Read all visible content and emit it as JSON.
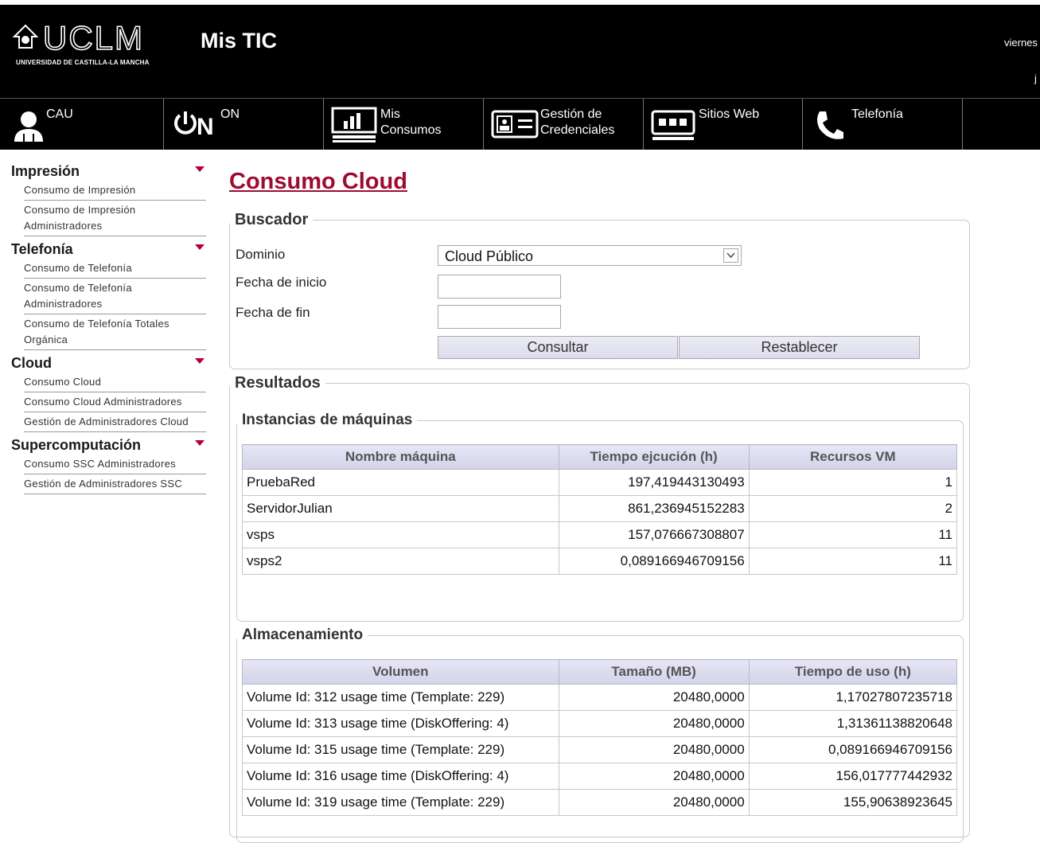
{
  "header": {
    "logo_text": "UCLM",
    "logo_subtitle": "UNIVERSIDAD DE CASTILLA-LA MANCHA",
    "app_title": "Mis TIC",
    "date_partial": "viernes",
    "user_partial": "j"
  },
  "nav": {
    "items": [
      {
        "label": "CAU",
        "icon": "person-icon"
      },
      {
        "label": "ON",
        "icon": "power-on-icon"
      },
      {
        "label": "Mis\nConsumos",
        "icon": "bar-chart-icon"
      },
      {
        "label": "Gestión de\nCredenciales",
        "icon": "id-card-icon"
      },
      {
        "label": "Sitios Web",
        "icon": "web-grid-icon"
      },
      {
        "label": "Telefonía",
        "icon": "phone-icon"
      }
    ]
  },
  "sidebar": {
    "sections": [
      {
        "title": "Impresión",
        "items": [
          "Consumo de Impresión",
          "Consumo de Impresión Administradores"
        ]
      },
      {
        "title": "Telefonía",
        "items": [
          "Consumo de Telefonía",
          "Consumo de Telefonía Administradores",
          "Consumo de Telefonía Totales Orgánica"
        ]
      },
      {
        "title": "Cloud",
        "items": [
          "Consumo Cloud",
          "Consumo Cloud Administradores",
          "Gestión de Administradores Cloud"
        ]
      },
      {
        "title": "Supercomputación",
        "items": [
          "Consumo SSC Administradores",
          "Gestión de Administradores SSC"
        ]
      }
    ]
  },
  "main": {
    "page_title": "Consumo Cloud",
    "buscador": {
      "legend": "Buscador",
      "dominio_label": "Dominio",
      "dominio_value": "Cloud Público",
      "fecha_inicio_label": "Fecha de inicio",
      "fecha_inicio_value": "",
      "fecha_fin_label": "Fecha de fin",
      "fecha_fin_value": "",
      "consultar_label": "Consultar",
      "restablecer_label": "Restablecer"
    },
    "resultados": {
      "legend": "Resultados",
      "instancias": {
        "legend": "Instancias de máquinas",
        "columns": [
          "Nombre máquina",
          "Tiempo ejcución (h)",
          "Recursos VM"
        ],
        "rows": [
          [
            "PruebaRed",
            "197,419443130493",
            "1"
          ],
          [
            "ServidorJulian",
            "861,236945152283",
            "2"
          ],
          [
            "vsps",
            "157,076667308807",
            "11"
          ],
          [
            "vsps2",
            "0,089166946709156",
            "11"
          ]
        ]
      },
      "almacenamiento": {
        "legend": "Almacenamiento",
        "columns": [
          "Volumen",
          "Tamaño (MB)",
          "Tiempo de uso (h)"
        ],
        "rows": [
          [
            "Volume Id: 312 usage time (Template: 229)",
            "20480,0000",
            "1,17027807235718"
          ],
          [
            "Volume Id: 313 usage time (DiskOffering: 4)",
            "20480,0000",
            "1,31361138820648"
          ],
          [
            "Volume Id: 315 usage time (Template: 229)",
            "20480,0000",
            "0,089166946709156"
          ],
          [
            "Volume Id: 316 usage time (DiskOffering: 4)",
            "20480,0000",
            "156,017777442932"
          ],
          [
            "Volume Id: 319 usage time (Template: 229)",
            "20480,0000",
            "155,90638923645"
          ]
        ]
      }
    }
  },
  "colors": {
    "header_bg": "#000000",
    "accent": "#9e0b2e",
    "sidebar_triangle": "#b5002d"
  }
}
